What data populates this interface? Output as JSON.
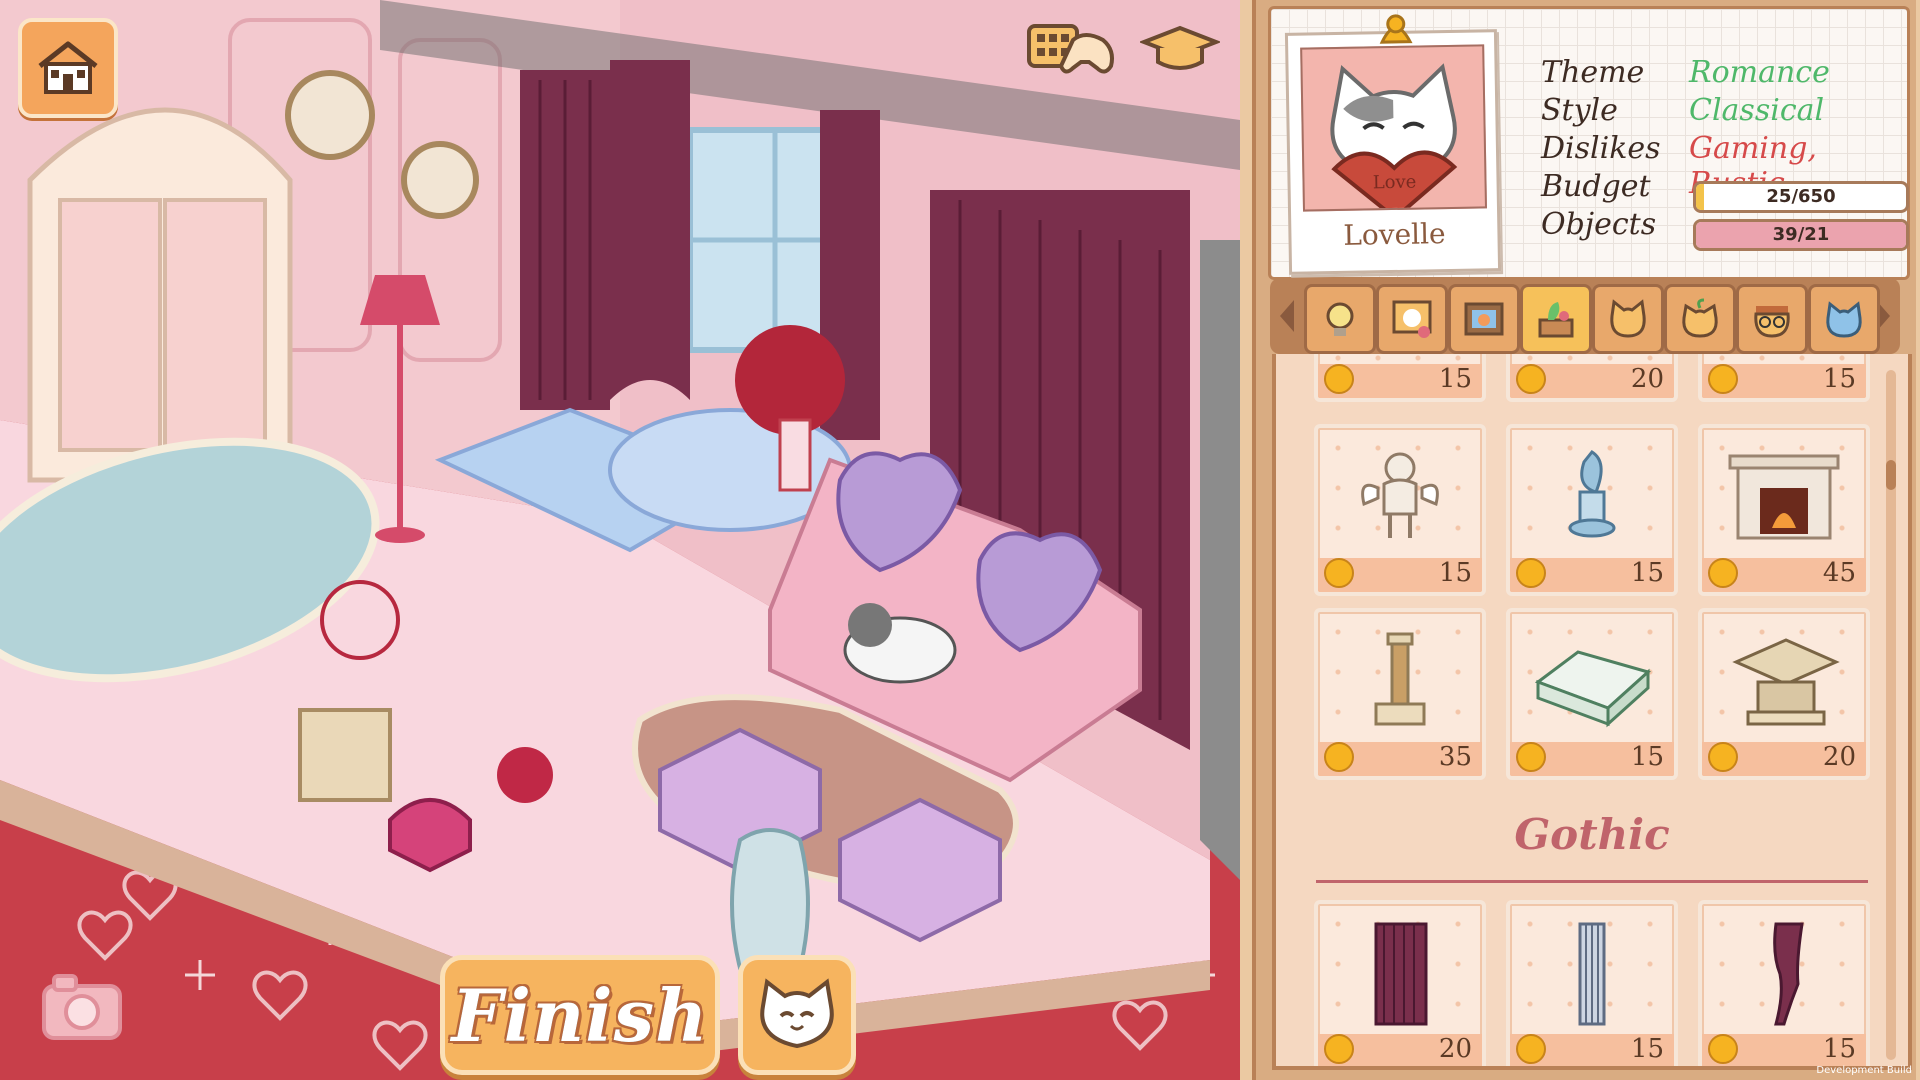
{
  "hud": {
    "finish_label": "Finish",
    "home_icon": "house-icon",
    "controller_icon": "gamepad-icon",
    "tutorial_icon": "graduation-cap-icon",
    "camera_icon": "camera-icon",
    "cat_icon": "cat-face-icon"
  },
  "client": {
    "name": "Lovelle",
    "portrait_text": "Love",
    "theme_label": "Theme",
    "theme_value": "Romance",
    "style_label": "Style",
    "style_value": "Classical",
    "dislikes_label": "Dislikes",
    "dislikes_value": "Gaming, Rustic",
    "budget_label": "Budget",
    "budget_text": "25/650",
    "budget_fraction": 0.04,
    "objects_label": "Objects",
    "objects_text": "39/21",
    "objects_fraction": 1.0,
    "colors": {
      "theme": "#4fb86a",
      "style": "#4fb86a",
      "dislikes": "#d64a4a",
      "budget_fill": "#f3c34a",
      "objects_fill": "#eba3ae"
    }
  },
  "tabs": [
    {
      "icon": "lightbulb-icon"
    },
    {
      "icon": "cat-painting-icon"
    },
    {
      "icon": "picture-frame-icon"
    },
    {
      "icon": "plant-box-icon",
      "active": true
    },
    {
      "icon": "cat-face-icon"
    },
    {
      "icon": "cat-plant-icon"
    },
    {
      "icon": "cat-glasses-icon"
    },
    {
      "icon": "cat-hat-icon"
    }
  ],
  "catalog": {
    "top_row_prices": [
      "15",
      "20",
      "15"
    ],
    "rows": [
      [
        {
          "icon": "cupid-statue-icon",
          "price": "15"
        },
        {
          "icon": "fish-statue-icon",
          "price": "15"
        },
        {
          "icon": "fireplace-icon",
          "price": "45"
        }
      ],
      [
        {
          "icon": "column-pedestal-icon",
          "price": "35"
        },
        {
          "icon": "stone-block-icon",
          "price": "15"
        },
        {
          "icon": "stone-pedestal-icon",
          "price": "20"
        }
      ]
    ],
    "section_title": "Gothic",
    "gothic_row": [
      {
        "icon": "dark-curtain-icon",
        "price": "20"
      },
      {
        "icon": "grey-curtain-icon",
        "price": "15"
      },
      {
        "icon": "tied-curtain-icon",
        "price": "15"
      }
    ]
  },
  "build_tag": "Development Build"
}
